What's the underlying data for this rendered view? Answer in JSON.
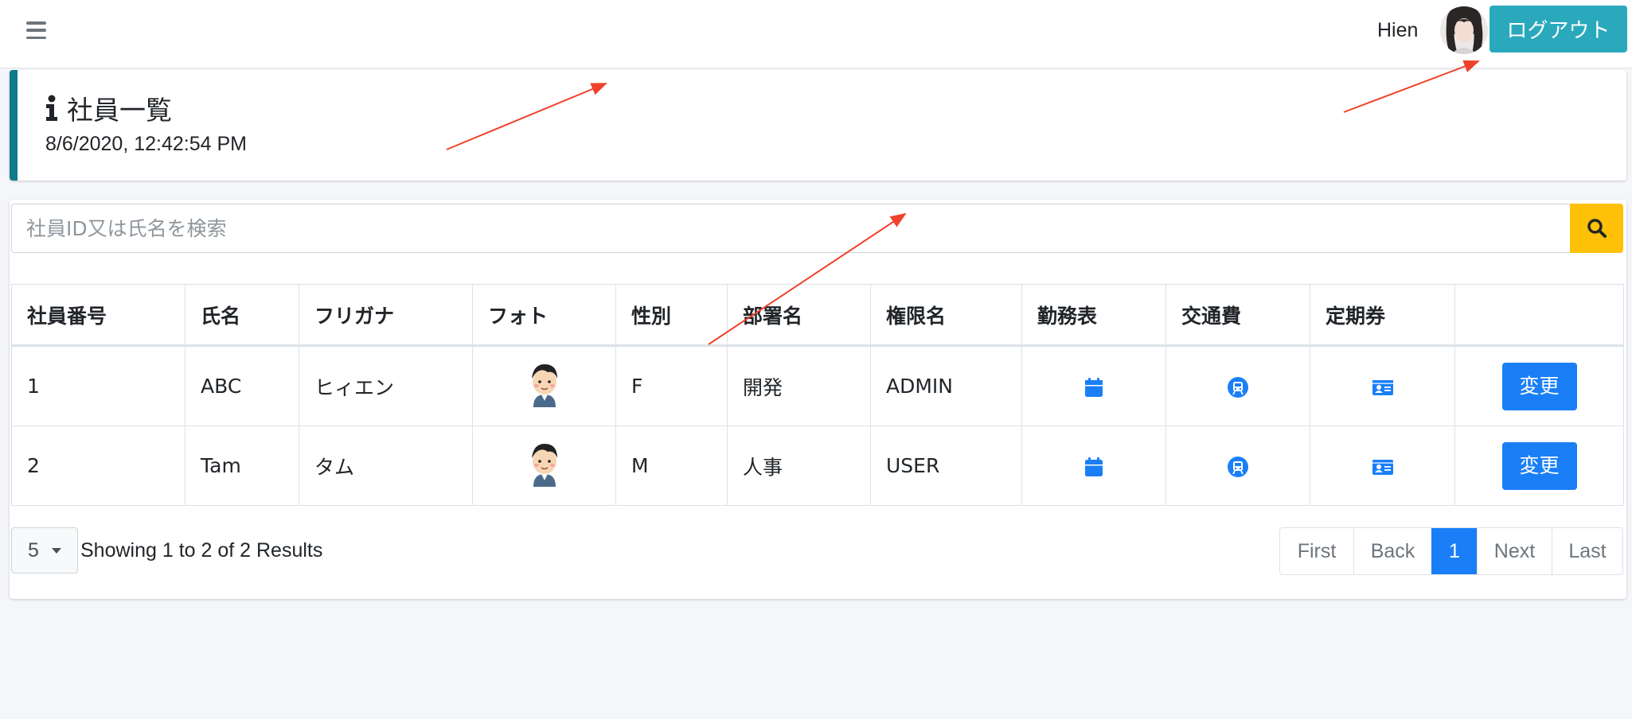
{
  "navbar": {
    "user_name": "Hien",
    "logout_label": "ログアウト"
  },
  "header": {
    "title": "社員一覧",
    "datetime": "8/6/2020, 12:42:54 PM"
  },
  "search": {
    "placeholder": "社員ID又は氏名を検索"
  },
  "table": {
    "columns": [
      "社員番号",
      "氏名",
      "フリガナ",
      "フォト",
      "性別",
      "部署名",
      "権限名",
      "勤務表",
      "交通費",
      "定期券",
      ""
    ],
    "rows": [
      {
        "id": "1",
        "name": "ABC",
        "furigana": "ヒィエン",
        "gender": "F",
        "department": "開発",
        "role": "ADMIN",
        "edit_label": "変更"
      },
      {
        "id": "2",
        "name": "Tam",
        "furigana": "タム",
        "gender": "M",
        "department": "人事",
        "role": "USER",
        "edit_label": "変更"
      }
    ]
  },
  "footer": {
    "page_size": "5",
    "showing_text": "Showing 1 to 2 of 2 Results"
  },
  "pagination": {
    "first": "First",
    "back": "Back",
    "current": "1",
    "next": "Next",
    "last": "Last"
  },
  "colors": {
    "accent_blue": "#1a7ff7",
    "logout_teal": "#2aa9bc",
    "callout_border": "#117a8b",
    "search_yellow": "#ffc107",
    "annotation_red": "#f0412a"
  },
  "icons": {
    "menu": "hamburger-icon",
    "info": "info-icon",
    "search": "search-icon",
    "timesheet": "calendar-icon",
    "transport": "train-icon",
    "commuter_pass": "id-card-icon"
  }
}
